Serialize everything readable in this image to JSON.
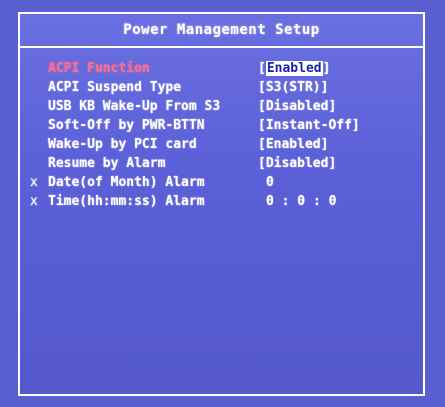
{
  "header": {
    "title": "Power Management Setup"
  },
  "items": [
    {
      "label": "ACPI Function",
      "value": "Enabled",
      "selected": true,
      "marker": ""
    },
    {
      "label": "ACPI Suspend Type",
      "value": "S3(STR)",
      "selected": false,
      "marker": ""
    },
    {
      "label": "USB KB Wake-Up From S3",
      "value": "Disabled",
      "selected": false,
      "marker": ""
    },
    {
      "label": "Soft-Off by PWR-BTTN",
      "value": "Instant-Off",
      "selected": false,
      "marker": ""
    },
    {
      "label": "Wake-Up by PCI card",
      "value": "Enabled",
      "selected": false,
      "marker": ""
    },
    {
      "label": "Resume by Alarm",
      "value": "Disabled",
      "selected": false,
      "marker": ""
    },
    {
      "label": "Date(of Month) Alarm",
      "value": "0",
      "selected": false,
      "marker": "x"
    },
    {
      "label": "Time(hh:mm:ss) Alarm",
      "value": "0 : 0 : 0",
      "selected": false,
      "marker": "x"
    }
  ],
  "colors": {
    "background": "#5a5fd0",
    "text": "#ffffff",
    "selected_label": "#ff6c8a",
    "highlight_bg": "#ffffff",
    "highlight_text": "#1b24a8"
  }
}
